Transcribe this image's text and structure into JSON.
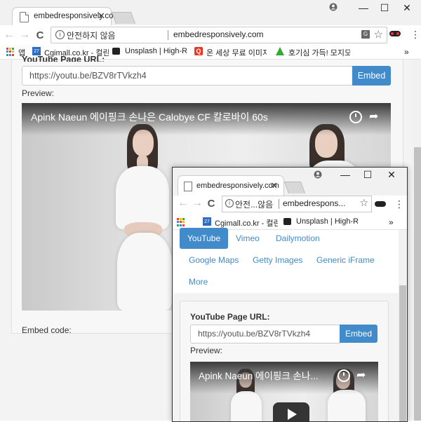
{
  "main_window": {
    "tab_title": "embedresponsively.com",
    "tab_close": "✕",
    "win_minimize": "—",
    "win_maximize": "☐",
    "win_close": "✕",
    "nav_back": "←",
    "nav_forward": "→",
    "nav_reload": "C",
    "security_text": "안전하지 않음",
    "url": "embedresponsively.com",
    "translate_glyph": "G",
    "star_glyph": "☆",
    "menu_glyph": "⋮",
    "bookmarks": [
      {
        "label": "앱"
      },
      {
        "label": "Cgimall.co.kr - 컬린다",
        "badge": "27"
      },
      {
        "label": "Unsplash | High-Res"
      },
      {
        "label": "온 세상 무료 이미지",
        "badge": "Q"
      },
      {
        "label": "호기심 가득! 모지모"
      }
    ],
    "bookmarks_more": "»",
    "page": {
      "label_cut": "YouTube Page URL:",
      "input_value": "https://youtu.be/BZV8rTVkzh4",
      "embed_label": "Embed",
      "preview_label": "Preview:",
      "video_title": "Apink Naeun 에이핑크 손나은 Calobye CF 칼로바이 60s",
      "share_glyph": "➦",
      "embed_code_label": "Embed code:"
    }
  },
  "small_window": {
    "tab_title": "embedresponsively.com",
    "tab_close": "✕",
    "win_minimize": "—",
    "win_maximize": "☐",
    "win_close": "✕",
    "nav_back": "←",
    "nav_forward": "→",
    "nav_reload": "C",
    "security_text": "안전...않음",
    "url": "embedrespons...",
    "star_glyph": "☆",
    "menu_glyph": "⋮",
    "bookmarks": [
      {
        "label": "Cgimall.co.kr - 컬린다",
        "badge": "27"
      },
      {
        "label": "Unsplash | High-Res"
      }
    ],
    "bookmarks_more": "»",
    "nav_tabs": [
      {
        "label": "YouTube",
        "active": true
      },
      {
        "label": "Vimeo"
      },
      {
        "label": "Dailymotion"
      },
      {
        "label": "Google Maps"
      },
      {
        "label": "Getty Images"
      },
      {
        "label": "Generic iFrame"
      },
      {
        "label": "More"
      }
    ],
    "page": {
      "label": "YouTube Page URL:",
      "input_value": "https://youtu.be/BZV8rTVkzh4",
      "embed_label": "Embed",
      "preview_label": "Preview:",
      "video_title": "Apink Naeun 에이핑크 손나...",
      "share_glyph": "➦"
    }
  },
  "colors": {
    "primary": "#428bca",
    "chrome_bg": "#f1f1f1",
    "page_bg": "#f3f3f3"
  }
}
